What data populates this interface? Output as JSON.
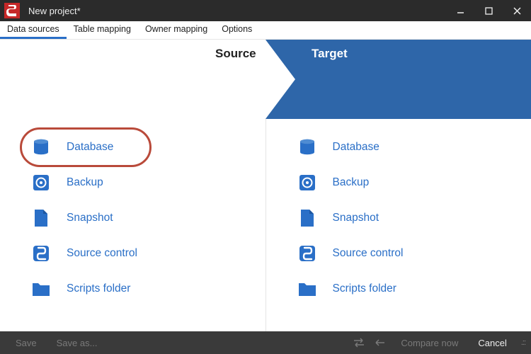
{
  "titlebar": {
    "title": "New project*"
  },
  "tabs": [
    {
      "label": "Data sources",
      "active": true
    },
    {
      "label": "Table mapping",
      "active": false
    },
    {
      "label": "Owner mapping",
      "active": false
    },
    {
      "label": "Options",
      "active": false
    }
  ],
  "band": {
    "source_label": "Source",
    "target_label": "Target"
  },
  "source_options": [
    {
      "icon": "database-icon",
      "label": "Database",
      "highlighted": true
    },
    {
      "icon": "backup-icon",
      "label": "Backup"
    },
    {
      "icon": "snapshot-icon",
      "label": "Snapshot"
    },
    {
      "icon": "source-control-icon",
      "label": "Source control"
    },
    {
      "icon": "folder-icon",
      "label": "Scripts folder"
    }
  ],
  "target_options": [
    {
      "icon": "database-icon",
      "label": "Database"
    },
    {
      "icon": "backup-icon",
      "label": "Backup"
    },
    {
      "icon": "snapshot-icon",
      "label": "Snapshot"
    },
    {
      "icon": "source-control-icon",
      "label": "Source control"
    },
    {
      "icon": "folder-icon",
      "label": "Scripts folder"
    }
  ],
  "bottombar": {
    "save": "Save",
    "save_as": "Save as...",
    "compare_now": "Compare now",
    "cancel": "Cancel"
  },
  "colors": {
    "accent": "#2a6fc7",
    "band_blue": "#2e66a9",
    "highlight_ring": "#b94a3a"
  }
}
